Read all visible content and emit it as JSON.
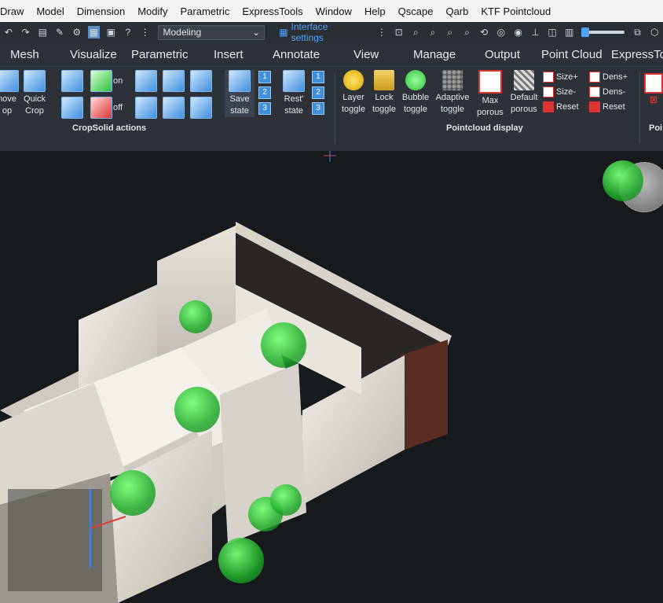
{
  "menu": [
    "Draw",
    "Model",
    "Dimension",
    "Modify",
    "Parametric",
    "ExpressTools",
    "Window",
    "Help",
    "Qscape",
    "Qarb",
    "KTF Pointcloud"
  ],
  "qat": {
    "workspace": "Modeling",
    "interface_settings": "Interface settings"
  },
  "tabs": [
    "Mesh",
    "Visualize",
    "Parametric",
    "Insert",
    "Annotate",
    "View",
    "Manage",
    "Output",
    "Point Cloud",
    "ExpressTo"
  ],
  "ribbon": {
    "crop": {
      "remove_crop": "nove op",
      "quick_crop": "Quick Crop",
      "on": "on",
      "off": "off",
      "save_state": "Save state",
      "rest_state": "Rest' state",
      "badges": [
        "1",
        "2",
        "3",
        "1",
        "2",
        "3"
      ],
      "panel_title": "CropSolid actions"
    },
    "pointcloud": {
      "layer_toggle": "Layer toggle",
      "lock_toggle": "Lock toggle",
      "bubble_toggle": "Bubble toggle",
      "adaptive_toggle": "Adaptive toggle",
      "max_porous": "Max porous",
      "default_porous": "Default porous",
      "size_plus": "Size+",
      "size_minus": "Size-",
      "reset1": "Reset",
      "dens_plus": "Dens+",
      "dens_minus": "Dens-",
      "reset2": "Reset",
      "panel_title": "Pointcloud display",
      "trailing_title": "Poi"
    }
  },
  "colors": {
    "accent": "#3f8fdc",
    "sphere": "#2fbf3a"
  }
}
